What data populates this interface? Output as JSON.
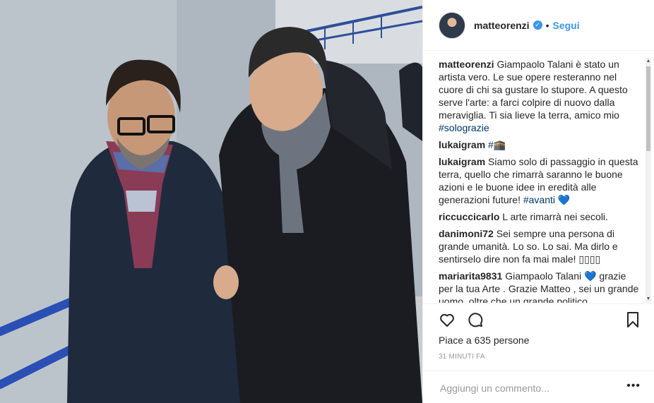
{
  "post": {
    "username": "matteorenzi",
    "follow_label": "Segui",
    "separator": "•"
  },
  "comments": [
    {
      "user": "matteorenzi",
      "text": "Giampaolo Talani è stato un artista vero. Le sue opere resteranno nel cuore di chi sa gustare lo stupore. A questo serve l'arte: a farci colpire di nuovo dalla meraviglia. Ti sia lieve la terra, amico mio ",
      "hashtag": "#solograzie"
    },
    {
      "user": "lukaigram",
      "text": "",
      "hashtag": "#🕋"
    },
    {
      "user": "lukaigram",
      "text": "Siamo solo di passaggio in questa terra, quello che rimarrà saranno le buone azioni e le buone idee in eredità alle generazioni future! ",
      "hashtag": "#avanti",
      "suffix": " 💙"
    },
    {
      "user": "riccuccicarlo",
      "text": "L arte rimarrà nei secoli."
    },
    {
      "user": "danimoni72",
      "text": "Sei sempre una persona di grande umanità. Lo so. Lo sai. Ma dirlo e sentirselo dire non fa mai male! ▯▯▯▯"
    },
    {
      "user": "mariarita9831",
      "text": "Giampaolo Talani 💙 grazie per la tua Arte . Grazie Matteo , sei un grande uomo, oltre che un grande politico"
    }
  ],
  "actions": {
    "likes_text": "Piace a 635 persone",
    "time_ago": "31 MINUTI FA"
  },
  "comment_input": {
    "placeholder": "Aggiungi un commento..."
  },
  "more_label": "•••",
  "icons": [
    "heart-icon",
    "comment-icon",
    "bookmark-icon",
    "verified-badge-icon",
    "more-options-icon"
  ],
  "colors": {
    "link": "#3897f0",
    "hashtag": "#003569",
    "text": "#262626",
    "muted": "#999999"
  }
}
